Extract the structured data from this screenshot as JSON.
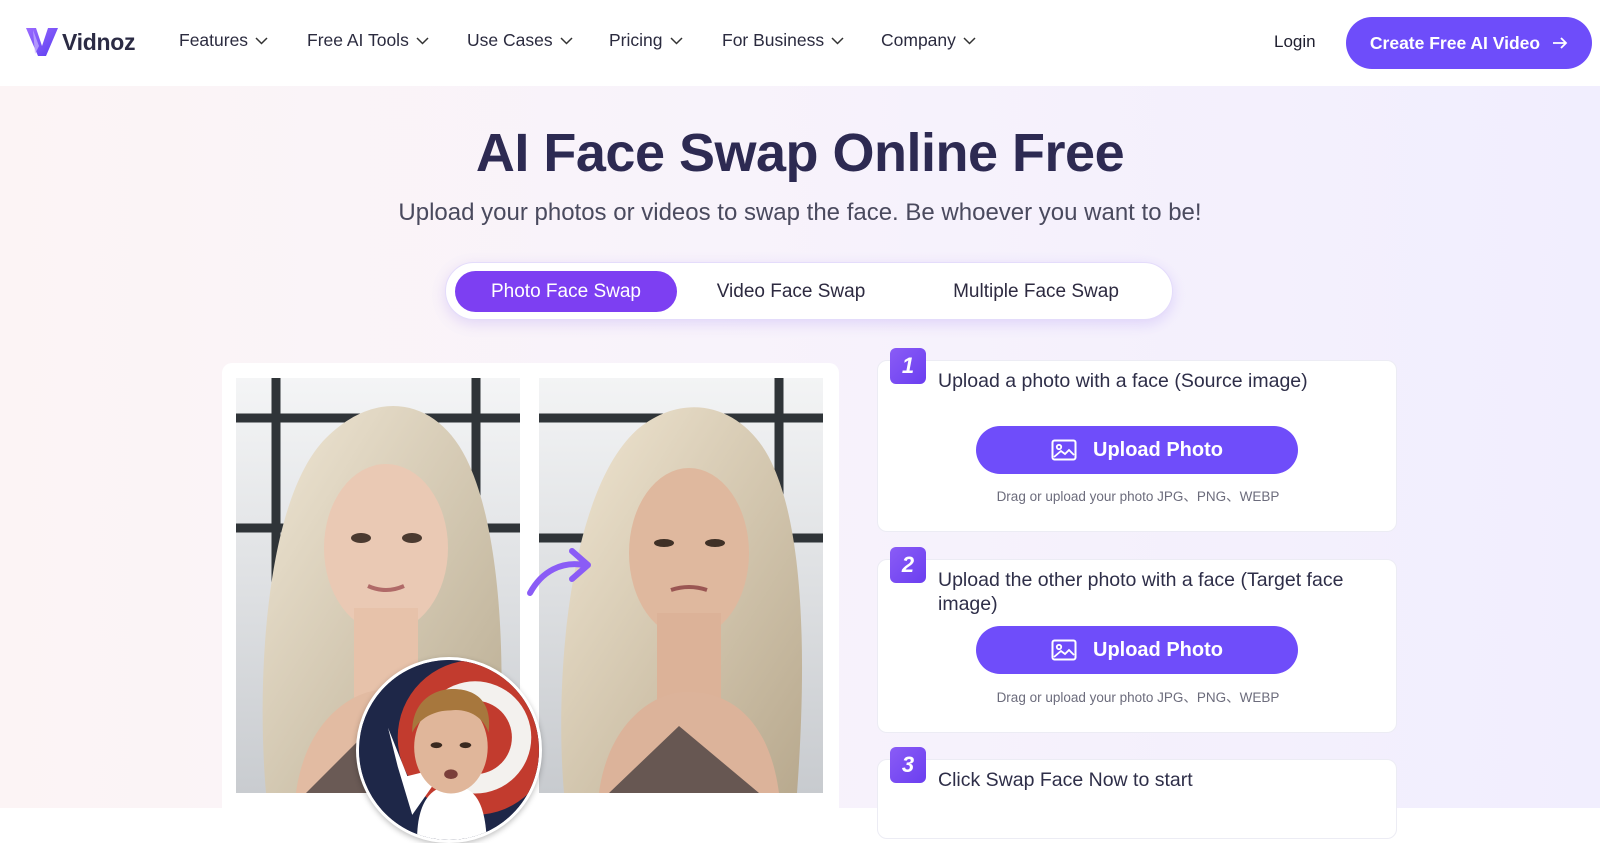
{
  "header": {
    "logo_text": "Vidnoz",
    "nav": [
      {
        "label": "Features",
        "icon": "chevron-down-icon"
      },
      {
        "label": "Free AI Tools",
        "icon": "chevron-down-icon"
      },
      {
        "label": "Use Cases",
        "icon": "chevron-down-icon"
      },
      {
        "label": "Pricing",
        "icon": "chevron-down-icon"
      },
      {
        "label": "For Business",
        "icon": "chevron-down-icon"
      },
      {
        "label": "Company",
        "icon": "chevron-down-icon"
      }
    ],
    "login_label": "Login",
    "cta_label": "Create Free AI Video"
  },
  "hero": {
    "title": "AI Face Swap Online Free",
    "subtitle": "Upload your photos or videos to swap the face. Be whoever you want to be!",
    "tabs": [
      {
        "label": "Photo Face Swap",
        "active": true
      },
      {
        "label": "Video Face Swap",
        "active": false
      },
      {
        "label": "Multiple Face Swap",
        "active": false
      }
    ]
  },
  "steps": [
    {
      "number": "1",
      "text": "Upload a photo with a face (Source image)",
      "button_label": "Upload Photo",
      "hint": "Drag or upload your photo  JPG、PNG、WEBP"
    },
    {
      "number": "2",
      "text": "Upload the other photo with a face (Target face image)",
      "button_label": "Upload Photo",
      "hint": "Drag or upload your photo  JPG、PNG、WEBP"
    },
    {
      "number": "3",
      "text": "Click Swap Face Now to start"
    }
  ],
  "colors": {
    "brand": "#6e4dfa",
    "tab_active": "#7d3ff2",
    "title": "#2d2a52"
  }
}
